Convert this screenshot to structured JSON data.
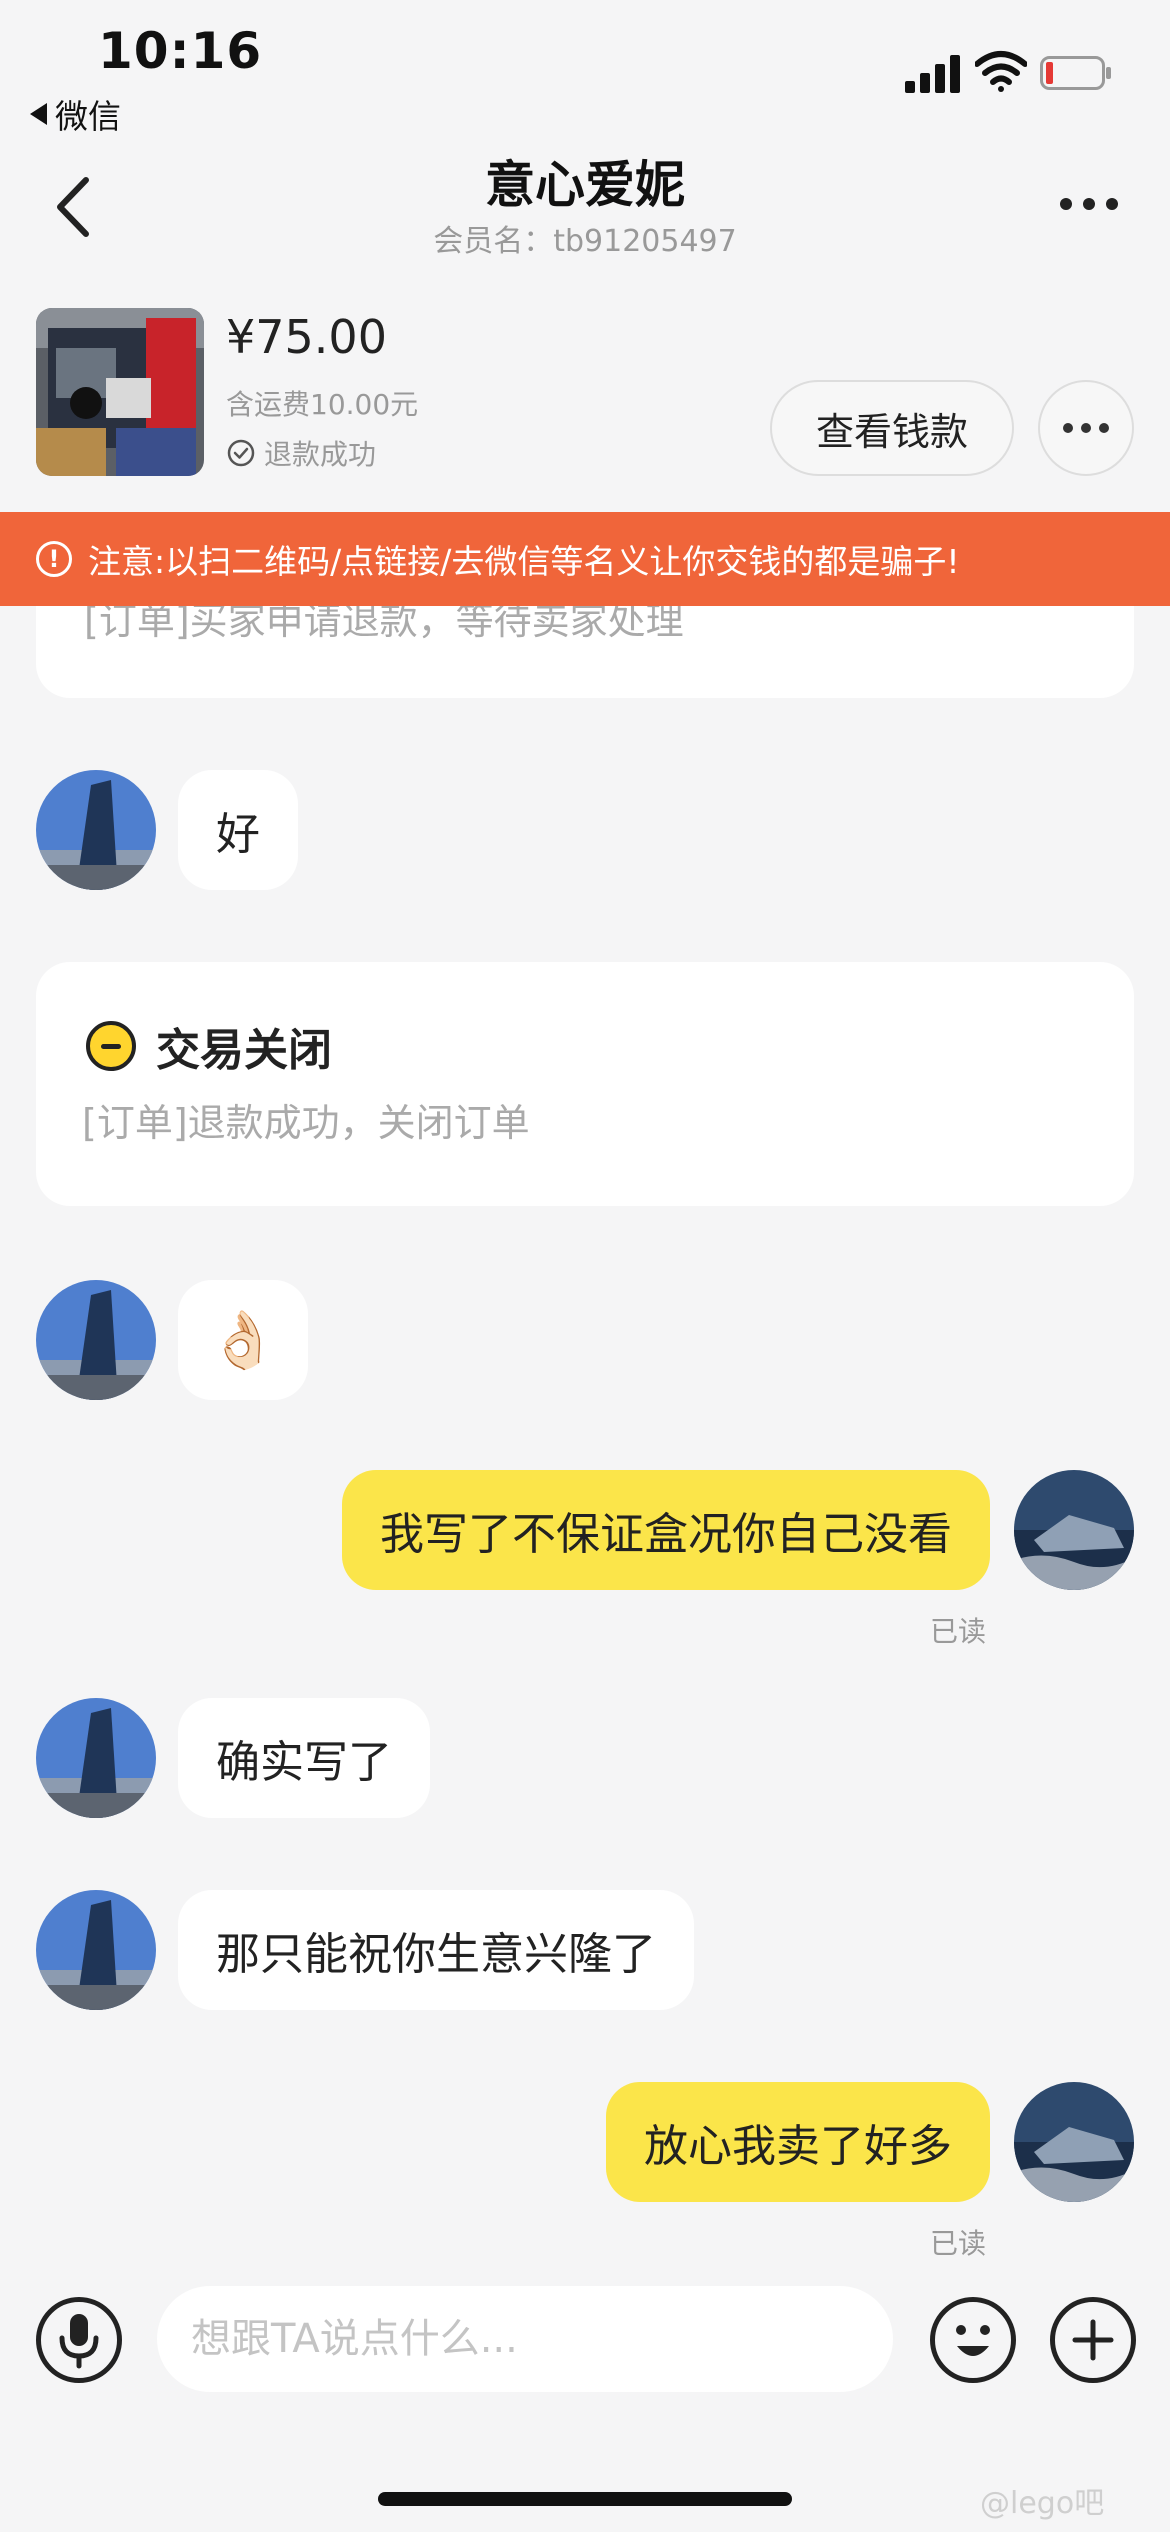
{
  "status_bar": {
    "time": "10:16",
    "back_app": "微信"
  },
  "header": {
    "title": "意心爱妮",
    "subtitle": "会员名：tb91205497"
  },
  "product": {
    "price": "¥75.00",
    "shipping": "含运费10.00元",
    "status": "退款成功",
    "view_money_button": "查看钱款"
  },
  "warning": {
    "text": "注意:以扫二维码/点链接/去微信等名义让你交钱的都是骗子!"
  },
  "messages": {
    "card_partial": "[订单]买家申请退款，等待卖家处理",
    "m1": "好",
    "card_close": {
      "title": "交易关闭",
      "detail": "[订单]退款成功，关闭订单"
    },
    "m2_emoji": "👌🏻",
    "m3": "我写了不保证盒况你自己没看",
    "m3_status": "已读",
    "m4": "确实写了",
    "m5": "那只能祝你生意兴隆了",
    "m6": "放心我卖了好多",
    "m6_status": "已读"
  },
  "input_bar": {
    "placeholder": "想跟TA说点什么..."
  },
  "watermark": "@lego吧",
  "colors": {
    "accent_yellow": "#fbe54a",
    "warning_orange": "#f0653a",
    "background": "#f5f5f6"
  },
  "icons": [
    "back-arrow-icon",
    "more-dots-icon",
    "check-circle-icon",
    "alert-circle-icon",
    "minus-circle-icon",
    "microphone-icon",
    "smiley-icon",
    "plus-circle-icon"
  ]
}
